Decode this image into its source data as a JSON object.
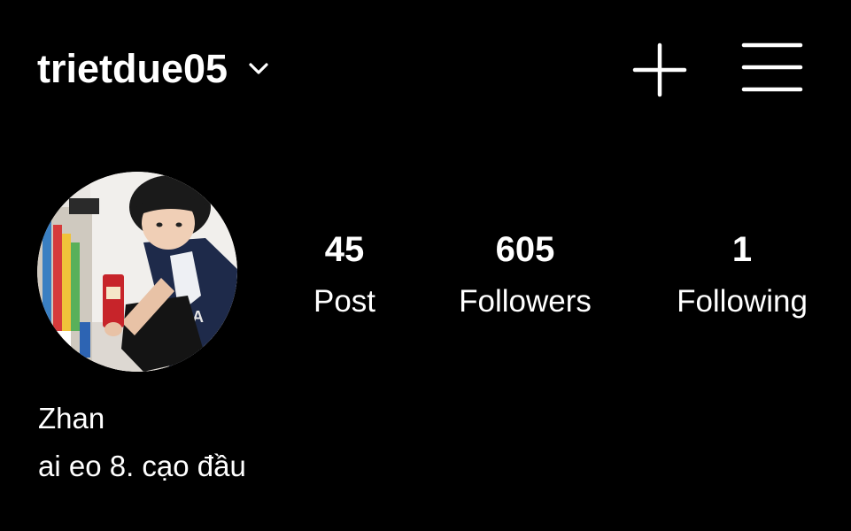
{
  "header": {
    "username": "trietdue05",
    "switcher_icon": "chevron-down-icon",
    "create_icon": "plus-icon",
    "menu_icon": "hamburger-menu-icon"
  },
  "profile": {
    "avatar": "profile-photo",
    "stats": [
      {
        "value": "45",
        "label": "Post"
      },
      {
        "value": "605",
        "label": "Followers"
      },
      {
        "value": "1",
        "label": "Following"
      }
    ],
    "display_name": "Zhan",
    "bio": "ai eo 8. cạo đầu"
  },
  "colors": {
    "background": "#000000",
    "text": "#ffffff"
  }
}
